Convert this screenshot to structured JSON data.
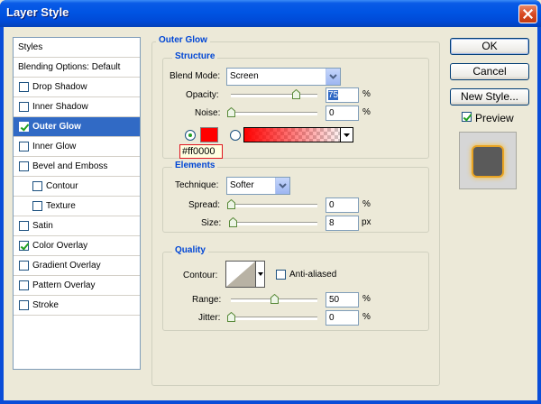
{
  "window": {
    "title": "Layer Style"
  },
  "styles_list": {
    "items": [
      {
        "label": "Styles",
        "checkbox": false,
        "checked": false,
        "selected": false
      },
      {
        "label": "Blending Options: Default",
        "checkbox": false,
        "checked": false,
        "selected": false
      },
      {
        "label": "Drop Shadow",
        "checkbox": true,
        "checked": false,
        "selected": false
      },
      {
        "label": "Inner Shadow",
        "checkbox": true,
        "checked": false,
        "selected": false
      },
      {
        "label": "Outer Glow",
        "checkbox": true,
        "checked": true,
        "selected": true
      },
      {
        "label": "Inner Glow",
        "checkbox": true,
        "checked": false,
        "selected": false
      },
      {
        "label": "Bevel and Emboss",
        "checkbox": true,
        "checked": false,
        "selected": false
      },
      {
        "label": "Contour",
        "checkbox": true,
        "checked": false,
        "selected": false,
        "indent": true
      },
      {
        "label": "Texture",
        "checkbox": true,
        "checked": false,
        "selected": false,
        "indent": true
      },
      {
        "label": "Satin",
        "checkbox": true,
        "checked": false,
        "selected": false
      },
      {
        "label": "Color Overlay",
        "checkbox": true,
        "checked": true,
        "selected": false
      },
      {
        "label": "Gradient Overlay",
        "checkbox": true,
        "checked": false,
        "selected": false
      },
      {
        "label": "Pattern Overlay",
        "checkbox": true,
        "checked": false,
        "selected": false
      },
      {
        "label": "Stroke",
        "checkbox": true,
        "checked": false,
        "selected": false
      }
    ]
  },
  "outer_glow": {
    "title": "Outer Glow",
    "structure": {
      "title": "Structure",
      "blend_mode_label": "Blend Mode:",
      "blend_mode_value": "Screen",
      "opacity_label": "Opacity:",
      "opacity_value": "75",
      "opacity_level": 0.75,
      "noise_label": "Noise:",
      "noise_value": "0",
      "noise_level": 0,
      "percent": "%",
      "color_hex": "#ff0000",
      "color_swatch": "#FF0000"
    },
    "elements": {
      "title": "Elements",
      "technique_label": "Technique:",
      "technique_value": "Softer",
      "spread_label": "Spread:",
      "spread_value": "0",
      "spread_level": 0,
      "size_label": "Size:",
      "size_value": "8",
      "size_level": 0.03,
      "percent": "%",
      "px": "px"
    },
    "quality": {
      "title": "Quality",
      "contour_label": "Contour:",
      "anti_aliased_label": "Anti-aliased",
      "anti_aliased": false,
      "range_label": "Range:",
      "range_value": "50",
      "range_level": 0.5,
      "jitter_label": "Jitter:",
      "jitter_value": "0",
      "jitter_level": 0,
      "percent": "%"
    }
  },
  "buttons": {
    "ok": "OK",
    "cancel": "Cancel",
    "new_style": "New Style...",
    "preview": "Preview",
    "preview_checked": true
  }
}
